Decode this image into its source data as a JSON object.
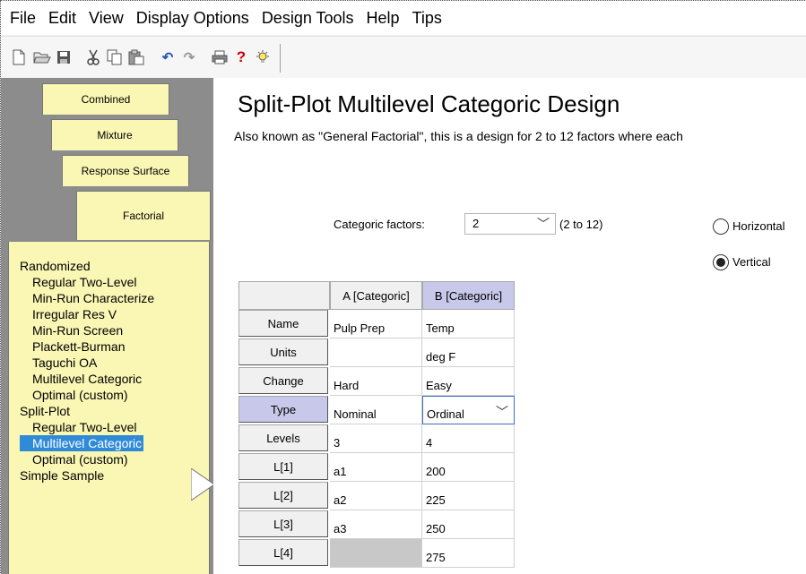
{
  "menu": [
    "File",
    "Edit",
    "View",
    "Display Options",
    "Design Tools",
    "Help",
    "Tips"
  ],
  "toolbar_icons": [
    "new-icon",
    "open-icon",
    "save-icon",
    "cut-icon",
    "copy-icon",
    "paste-icon",
    "undo-icon",
    "redo-icon",
    "print-icon",
    "help-icon",
    "tip-icon"
  ],
  "tabs": {
    "combined": "Combined",
    "mixture": "Mixture",
    "response_surface": "Response Surface",
    "factorial": "Factorial"
  },
  "nav": {
    "randomized": "Randomized",
    "regular_two_level": "Regular Two-Level",
    "min_run_characterize": "Min-Run Characterize",
    "irregular_res_v": "Irregular Res V",
    "min_run_screen": "Min-Run Screen",
    "plackett_burman": "Plackett-Burman",
    "taguchi_oa": "Taguchi OA",
    "multilevel_categoric": "Multilevel Categoric",
    "optimal_custom": "Optimal (custom)",
    "split_plot": "Split-Plot",
    "sp_regular_two_level": "Regular Two-Level",
    "sp_multilevel_categoric": "Multilevel Categoric",
    "sp_optimal_custom": "Optimal (custom)",
    "simple_sample": "Simple Sample"
  },
  "main": {
    "title": "Split-Plot Multilevel Categoric Design",
    "subtitle": "Also known as \"General Factorial\", this is a design for 2 to 12 factors where each",
    "categoric_factors_label": "Categoric factors:",
    "categoric_factors_value": "2",
    "range_label": "(2 to 12)",
    "horizontal_label": "Horizontal",
    "vertical_label": "Vertical",
    "orientation_selected": "Vertical"
  },
  "grid": {
    "columns": [
      "A [Categoric]",
      "B [Categoric]"
    ],
    "rows": [
      {
        "label": "Name",
        "a": "Pulp Prep",
        "b": "Temp"
      },
      {
        "label": "Units",
        "a": "",
        "b": "deg F"
      },
      {
        "label": "Change",
        "a": "Hard",
        "b": "Easy"
      },
      {
        "label": "Type",
        "a": "Nominal",
        "b": "Ordinal"
      },
      {
        "label": "Levels",
        "a": "3",
        "b": "4"
      },
      {
        "label": "L[1]",
        "a": "a1",
        "b": "200"
      },
      {
        "label": "L[2]",
        "a": "a2",
        "b": "225"
      },
      {
        "label": "L[3]",
        "a": "a3",
        "b": "250"
      },
      {
        "label": "L[4]",
        "a": "",
        "b": "275"
      }
    ]
  },
  "colors": {
    "tab_yellow": "#faf6b4",
    "selection_blue": "#2f8bd8",
    "selected_header": "#c8c8ea"
  }
}
